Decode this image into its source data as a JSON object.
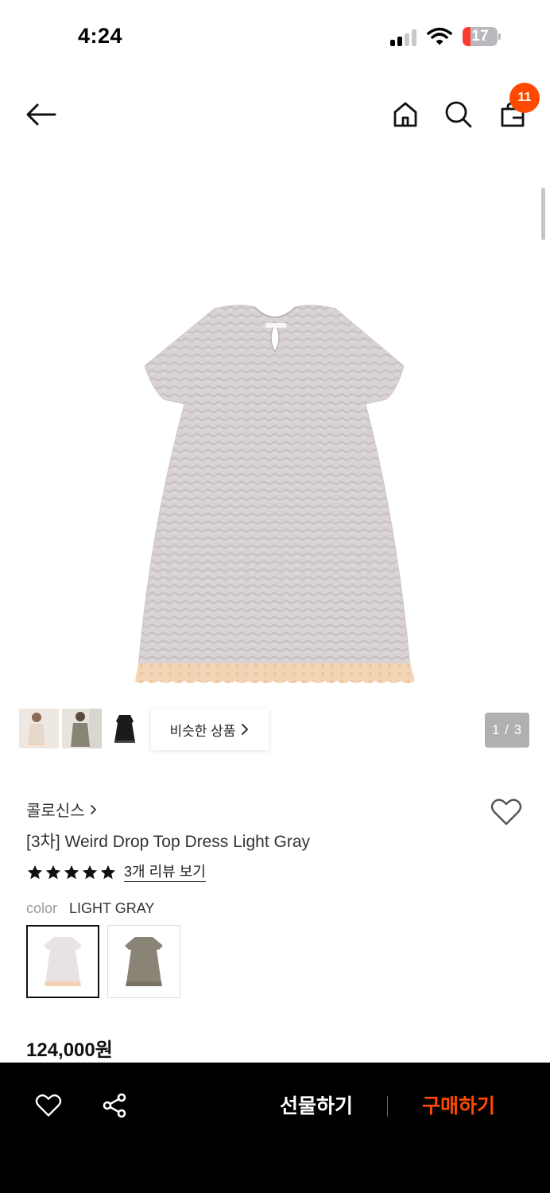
{
  "status_bar": {
    "time": "4:24",
    "battery_level": "17",
    "icons": [
      "signal-icon",
      "wifi-icon",
      "battery-icon"
    ]
  },
  "header": {
    "cart_count": "11",
    "icons": [
      "back-arrow-icon",
      "home-icon",
      "search-icon",
      "cart-icon"
    ]
  },
  "gallery": {
    "page_indicator": "1 / 3",
    "similar_products_label": "비슷한 상품",
    "thumbnails": [
      "model-beige-thumbnail",
      "model-khaki-thumbnail",
      "black-dress-thumbnail"
    ]
  },
  "product": {
    "brand": "콜로신스",
    "title": "[3차] Weird Drop Top Dress Light Gray",
    "rating_stars": 5,
    "review_link": "3개 리뷰 보기",
    "color_label": "color",
    "color_value": "LIGHT GRAY",
    "color_options": [
      "LIGHT GRAY",
      "KHAKI"
    ],
    "price": "124,000원"
  },
  "bottom_bar": {
    "gift_label": "선물하기",
    "buy_label": "구매하기",
    "icons": [
      "heart-icon",
      "share-icon"
    ]
  },
  "colors": {
    "accent": "#ff4800",
    "bottom_bar_bg": "#000000",
    "dress_gray": "#d6cfcf",
    "lace_peach": "#f3d3b3",
    "dress_khaki": "#8a8476"
  }
}
